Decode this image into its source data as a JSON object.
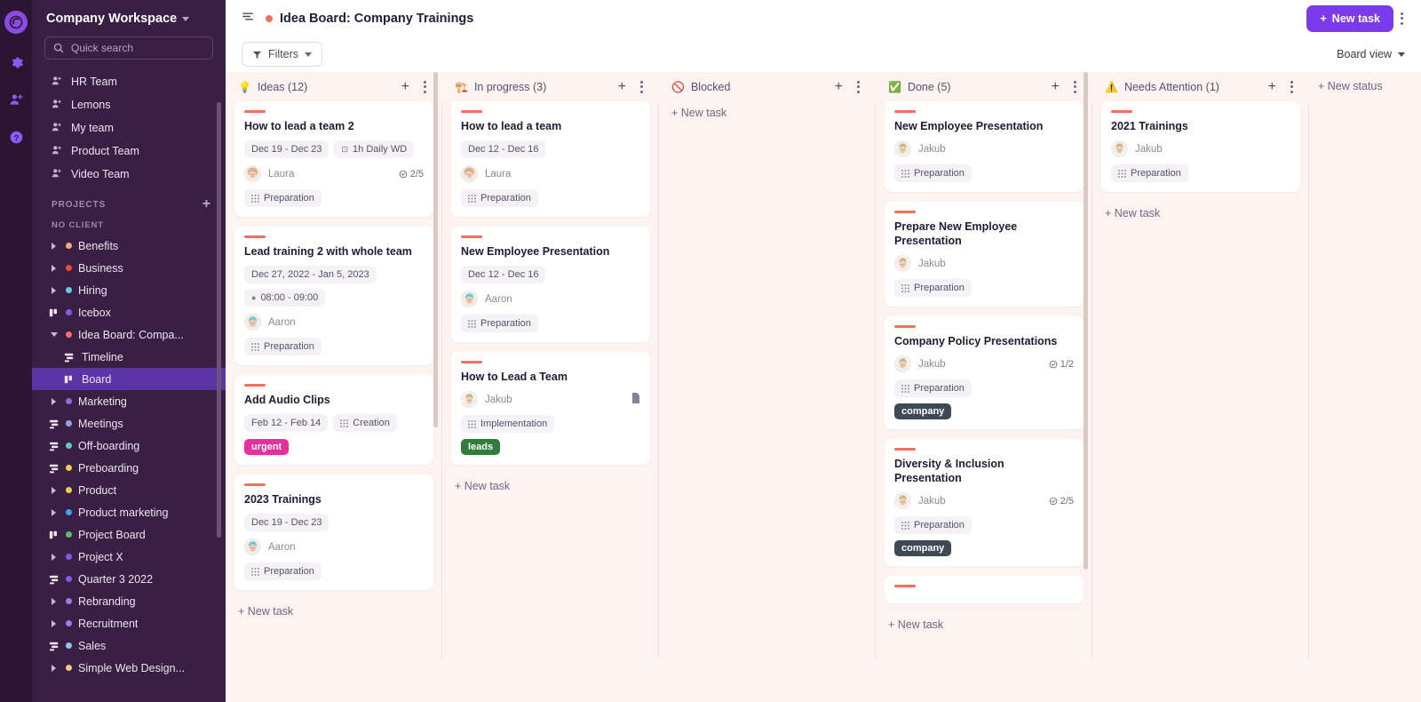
{
  "rail": {
    "logo": "app-logo",
    "icons": [
      {
        "name": "gear-icon",
        "label": "Settings"
      },
      {
        "name": "add-person-icon",
        "label": "Invite people"
      },
      {
        "name": "help-icon",
        "label": "Help"
      }
    ]
  },
  "sidebar": {
    "workspace": "Company Workspace",
    "search_placeholder": "Quick search",
    "teams": [
      {
        "label": "HR Team"
      },
      {
        "label": "Lemons"
      },
      {
        "label": "My team"
      },
      {
        "label": "Product Team"
      },
      {
        "label": "Video Team"
      }
    ],
    "projects_header": "PROJECTS",
    "no_client_label": "NO CLIENT",
    "projects": [
      {
        "label": "Benefits",
        "dot": "#f4a97a",
        "icon": "arrow-right",
        "children": []
      },
      {
        "label": "Business",
        "dot": "#ef4a3a",
        "icon": "arrow-right",
        "children": []
      },
      {
        "label": "Hiring",
        "dot": "#5ecfd6",
        "icon": "arrow-right",
        "children": []
      },
      {
        "label": "Icebox",
        "dot": "#7d5de0",
        "icon": "board",
        "children": []
      },
      {
        "label": "Idea Board: Compa...",
        "dot": "#f2705d",
        "icon": "arrow-down",
        "children": [
          {
            "label": "Timeline",
            "icon": "timeline",
            "selected": false
          },
          {
            "label": "Board",
            "icon": "board",
            "selected": true
          }
        ]
      },
      {
        "label": "Marketing",
        "dot": "#8b6ae4",
        "icon": "arrow-right",
        "children": []
      },
      {
        "label": "Meetings",
        "dot": "#8fa5e8",
        "icon": "timeline",
        "children": []
      },
      {
        "label": "Off-boarding",
        "dot": "#57cfc0",
        "icon": "timeline",
        "children": []
      },
      {
        "label": "Preboarding",
        "dot": "#f2c94c",
        "icon": "timeline",
        "children": []
      },
      {
        "label": "Product",
        "dot": "#f2c94c",
        "icon": "arrow-right",
        "children": []
      },
      {
        "label": "Product marketing",
        "dot": "#3fa0ef",
        "icon": "arrow-right",
        "children": []
      },
      {
        "label": "Project Board",
        "dot": "#5fbb6b",
        "icon": "board",
        "children": []
      },
      {
        "label": "Project X",
        "dot": "#7d5de0",
        "icon": "arrow-right",
        "children": []
      },
      {
        "label": "Quarter 3 2022",
        "dot": "#7d5de0",
        "icon": "timeline",
        "children": []
      },
      {
        "label": "Rebranding",
        "dot": "#9b7ce8",
        "icon": "arrow-right",
        "children": []
      },
      {
        "label": "Recruitment",
        "dot": "#9b7ce8",
        "icon": "arrow-right",
        "children": []
      },
      {
        "label": "Sales",
        "dot": "#8fc7ea",
        "icon": "timeline",
        "children": []
      },
      {
        "label": "Simple Web Design...",
        "dot": "#f2c98c",
        "icon": "arrow-right",
        "children": []
      }
    ]
  },
  "header": {
    "sort_icon": "sort-icon",
    "board_title": "Idea Board: Company Trainings",
    "board_dot_color": "#f2705d",
    "new_task_label": "New task",
    "new_task_color": "#7c3aed",
    "more_icon": "kebab-icon",
    "filters_label": "Filters",
    "board_view_label": "Board view"
  },
  "board": {
    "new_status_label": "+ New status",
    "new_task_label": "+ New task",
    "columns": [
      {
        "emoji": "💡",
        "icon_name": "lightbulb-icon",
        "title": "Ideas (12)",
        "cards": [
          {
            "title": "How to lead a team 2",
            "bar": "#f2705d",
            "chips": [
              {
                "text": "Dec 19 - Dec 23",
                "icon": ""
              },
              {
                "text": "1h Daily WD",
                "icon": "⊡"
              }
            ],
            "assignee": "Laura",
            "avatar": "laura",
            "count": "2/5",
            "group": "Preparation",
            "tags": []
          },
          {
            "title": "Lead training 2 with whole team",
            "bar": "#f2705d",
            "chips": [
              {
                "text": "Dec 27, 2022 - Jan 5, 2023",
                "icon": ""
              },
              {
                "text": "08:00 - 09:00",
                "icon": "●"
              }
            ],
            "assignee": "Aaron",
            "avatar": "aaron",
            "count": "",
            "group": "Preparation",
            "tags": []
          },
          {
            "title": "Add Audio Clips",
            "bar": "#f2705d",
            "chips": [
              {
                "text": "Feb 12 - Feb 14",
                "icon": ""
              },
              {
                "text": "Creation",
                "icon": "grid"
              }
            ],
            "assignee": "",
            "avatar": "",
            "count": "",
            "group": "",
            "tags": [
              {
                "label": "urgent",
                "color": "#e8309c"
              }
            ]
          },
          {
            "title": "2023 Trainings",
            "bar": "#f2705d",
            "chips": [
              {
                "text": "Dec 19 - Dec 23",
                "icon": ""
              }
            ],
            "assignee": "Aaron",
            "avatar": "aaron",
            "count": "",
            "group": "Preparation",
            "tags": []
          }
        ]
      },
      {
        "emoji": "🏗️",
        "icon_name": "construction-icon",
        "title": "In progress (3)",
        "cards": [
          {
            "title": "How to lead a team",
            "bar": "#f2705d",
            "chips": [
              {
                "text": "Dec 12 - Dec 16",
                "icon": ""
              }
            ],
            "assignee": "Laura",
            "avatar": "laura",
            "count": "",
            "group": "Preparation",
            "tags": []
          },
          {
            "title": "New Employee Presentation",
            "bar": "#f2705d",
            "chips": [
              {
                "text": "Dec 12 - Dec 16",
                "icon": ""
              }
            ],
            "assignee": "Aaron",
            "avatar": "aaron",
            "count": "",
            "group": "Preparation",
            "tags": []
          },
          {
            "title": "How to Lead a Team",
            "bar": "#f2705d",
            "chips": [],
            "assignee": "Jakub",
            "avatar": "jakub",
            "count": "",
            "doc": true,
            "group": "Implementation",
            "tags": [
              {
                "label": "leads",
                "color": "#2f7d3b"
              }
            ]
          }
        ]
      },
      {
        "emoji": "🚫",
        "icon_name": "blocked-icon",
        "title": "Blocked",
        "cards": []
      },
      {
        "emoji": "✅",
        "icon_name": "check-icon",
        "title": "Done (5)",
        "cards": [
          {
            "title": "New Employee Presentation",
            "bar": "#f2705d",
            "chips": [],
            "assignee": "Jakub",
            "avatar": "jakub",
            "count": "",
            "group": "Preparation",
            "tags": []
          },
          {
            "title": "Prepare New Employee Presentation",
            "bar": "#f2705d",
            "chips": [],
            "assignee": "Jakub",
            "avatar": "jakub",
            "count": "",
            "group": "Preparation",
            "tags": []
          },
          {
            "title": "Company Policy Presentations",
            "bar": "#f2705d",
            "chips": [],
            "assignee": "Jakub",
            "avatar": "jakub",
            "count": "1/2",
            "group": "Preparation",
            "tags": [
              {
                "label": "company",
                "color": "#3e4a56"
              }
            ]
          },
          {
            "title": "Diversity & Inclusion Presentation",
            "bar": "#f2705d",
            "chips": [],
            "assignee": "Jakub",
            "avatar": "jakub",
            "count": "2/5",
            "group": "Preparation",
            "tags": [
              {
                "label": "company",
                "color": "#3e4a56"
              }
            ]
          },
          {
            "title": "",
            "bar": "#f2705d",
            "chips": [],
            "assignee": "",
            "avatar": "",
            "count": "",
            "group": "",
            "tags": []
          }
        ]
      },
      {
        "emoji": "⚠️",
        "icon_name": "warning-icon",
        "title": "Needs Attention (1)",
        "cards": [
          {
            "title": "2021 Trainings",
            "bar": "#f2705d",
            "chips": [],
            "assignee": "Jakub",
            "avatar": "jakub",
            "count": "",
            "group": "Preparation",
            "tags": []
          }
        ]
      }
    ]
  }
}
